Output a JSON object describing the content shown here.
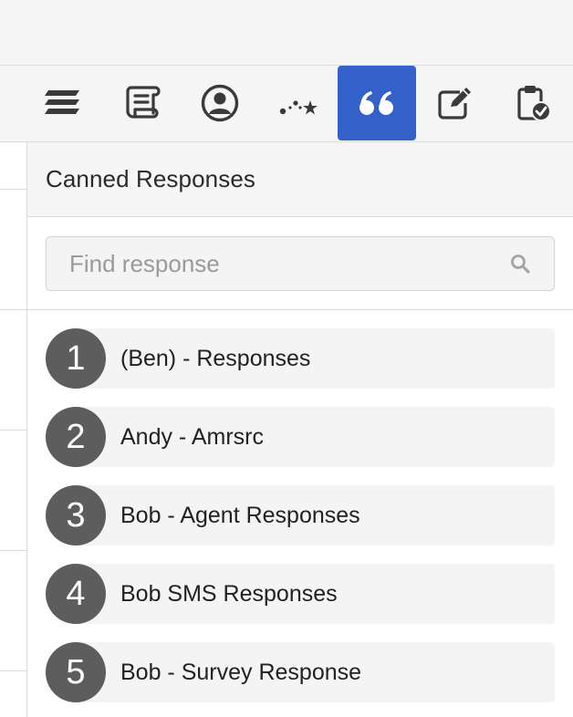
{
  "toolbar": {
    "buttons": [
      {
        "icon": "stack-icon",
        "active": false
      },
      {
        "icon": "scroll-script-icon",
        "active": false
      },
      {
        "icon": "user-circle-icon",
        "active": false
      },
      {
        "icon": "constellation-icon",
        "active": false
      },
      {
        "icon": "quote-icon",
        "active": true
      },
      {
        "icon": "edit-icon",
        "active": false
      },
      {
        "icon": "clipboard-check-icon",
        "active": false
      }
    ],
    "active_color": "#3461c9"
  },
  "panel": {
    "title": "Canned Responses",
    "search": {
      "placeholder": "Find response",
      "value": ""
    },
    "items": [
      {
        "number": "1",
        "label": "(Ben) - Responses"
      },
      {
        "number": "2",
        "label": "Andy - Amrsrc"
      },
      {
        "number": "3",
        "label": "Bob - Agent Responses"
      },
      {
        "number": "4",
        "label": "Bob SMS Responses"
      },
      {
        "number": "5",
        "label": "Bob - Survey Response"
      }
    ]
  }
}
